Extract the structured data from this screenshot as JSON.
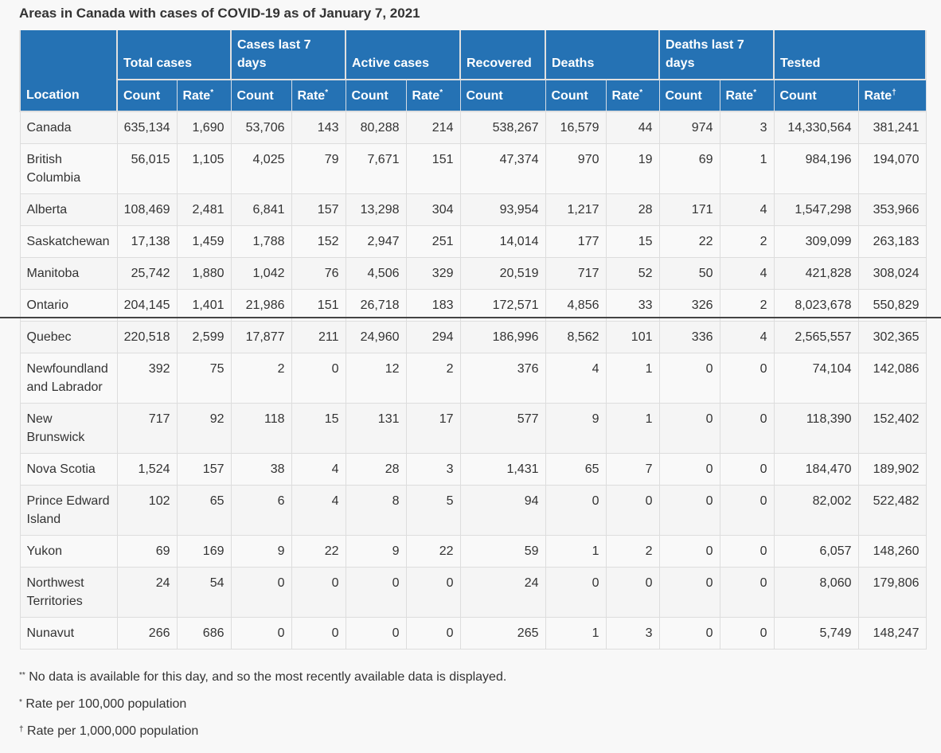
{
  "title": "Areas in Canada with cases of COVID-19 as of January 7, 2021",
  "header": {
    "location": "Location",
    "groups": [
      "Total cases",
      "Cases last 7 days",
      "Active cases",
      "Recovered",
      "Deaths",
      "Deaths last 7 days",
      "Tested"
    ],
    "sub": [
      "Count",
      "Rate",
      "Count",
      "Rate",
      "Count",
      "Rate",
      "Count",
      "Count",
      "Rate",
      "Count",
      "Rate",
      "Count",
      "Rate"
    ],
    "rate_mark": "*",
    "tested_rate_mark": "†"
  },
  "rows": [
    [
      "Canada",
      "635,134",
      "1,690",
      "53,706",
      "143",
      "80,288",
      "214",
      "538,267",
      "16,579",
      "44",
      "974",
      "3",
      "14,330,564",
      "381,241"
    ],
    [
      "British Columbia",
      "56,015",
      "1,105",
      "4,025",
      "79",
      "7,671",
      "151",
      "47,374",
      "970",
      "19",
      "69",
      "1",
      "984,196",
      "194,070"
    ],
    [
      "Alberta",
      "108,469",
      "2,481",
      "6,841",
      "157",
      "13,298",
      "304",
      "93,954",
      "1,217",
      "28",
      "171",
      "4",
      "1,547,298",
      "353,966"
    ],
    [
      "Saskatchewan",
      "17,138",
      "1,459",
      "1,788",
      "152",
      "2,947",
      "251",
      "14,014",
      "177",
      "15",
      "22",
      "2",
      "309,099",
      "263,183"
    ],
    [
      "Manitoba",
      "25,742",
      "1,880",
      "1,042",
      "76",
      "4,506",
      "329",
      "20,519",
      "717",
      "52",
      "50",
      "4",
      "421,828",
      "308,024"
    ],
    [
      "Ontario",
      "204,145",
      "1,401",
      "21,986",
      "151",
      "26,718",
      "183",
      "172,571",
      "4,856",
      "33",
      "326",
      "2",
      "8,023,678",
      "550,829"
    ],
    [
      "Quebec",
      "220,518",
      "2,599",
      "17,877",
      "211",
      "24,960",
      "294",
      "186,996",
      "8,562",
      "101",
      "336",
      "4",
      "2,565,557",
      "302,365"
    ],
    [
      "Newfoundland and Labrador",
      "392",
      "75",
      "2",
      "0",
      "12",
      "2",
      "376",
      "4",
      "1",
      "0",
      "0",
      "74,104",
      "142,086"
    ],
    [
      "New Brunswick",
      "717",
      "92",
      "118",
      "15",
      "131",
      "17",
      "577",
      "9",
      "1",
      "0",
      "0",
      "118,390",
      "152,402"
    ],
    [
      "Nova Scotia",
      "1,524",
      "157",
      "38",
      "4",
      "28",
      "3",
      "1,431",
      "65",
      "7",
      "0",
      "0",
      "184,470",
      "189,902"
    ],
    [
      "Prince Edward Island",
      "102",
      "65",
      "6",
      "4",
      "8",
      "5",
      "94",
      "0",
      "0",
      "0",
      "0",
      "82,002",
      "522,482"
    ],
    [
      "Yukon",
      "69",
      "169",
      "9",
      "22",
      "9",
      "22",
      "59",
      "1",
      "2",
      "0",
      "0",
      "6,057",
      "148,260"
    ],
    [
      "Northwest Territories",
      "24",
      "54",
      "0",
      "0",
      "0",
      "0",
      "24",
      "0",
      "0",
      "0",
      "0",
      "8,060",
      "179,806"
    ],
    [
      "Nunavut",
      "266",
      "686",
      "0",
      "0",
      "0",
      "0",
      "265",
      "1",
      "3",
      "0",
      "0",
      "5,749",
      "148,247"
    ]
  ],
  "notes": [
    {
      "mark": "**",
      "text": "No data is available for this day, and so the most recently available data is displayed."
    },
    {
      "mark": "*",
      "text": "Rate per 100,000 population"
    },
    {
      "mark": "†",
      "text": "Rate per 1,000,000 population"
    }
  ]
}
